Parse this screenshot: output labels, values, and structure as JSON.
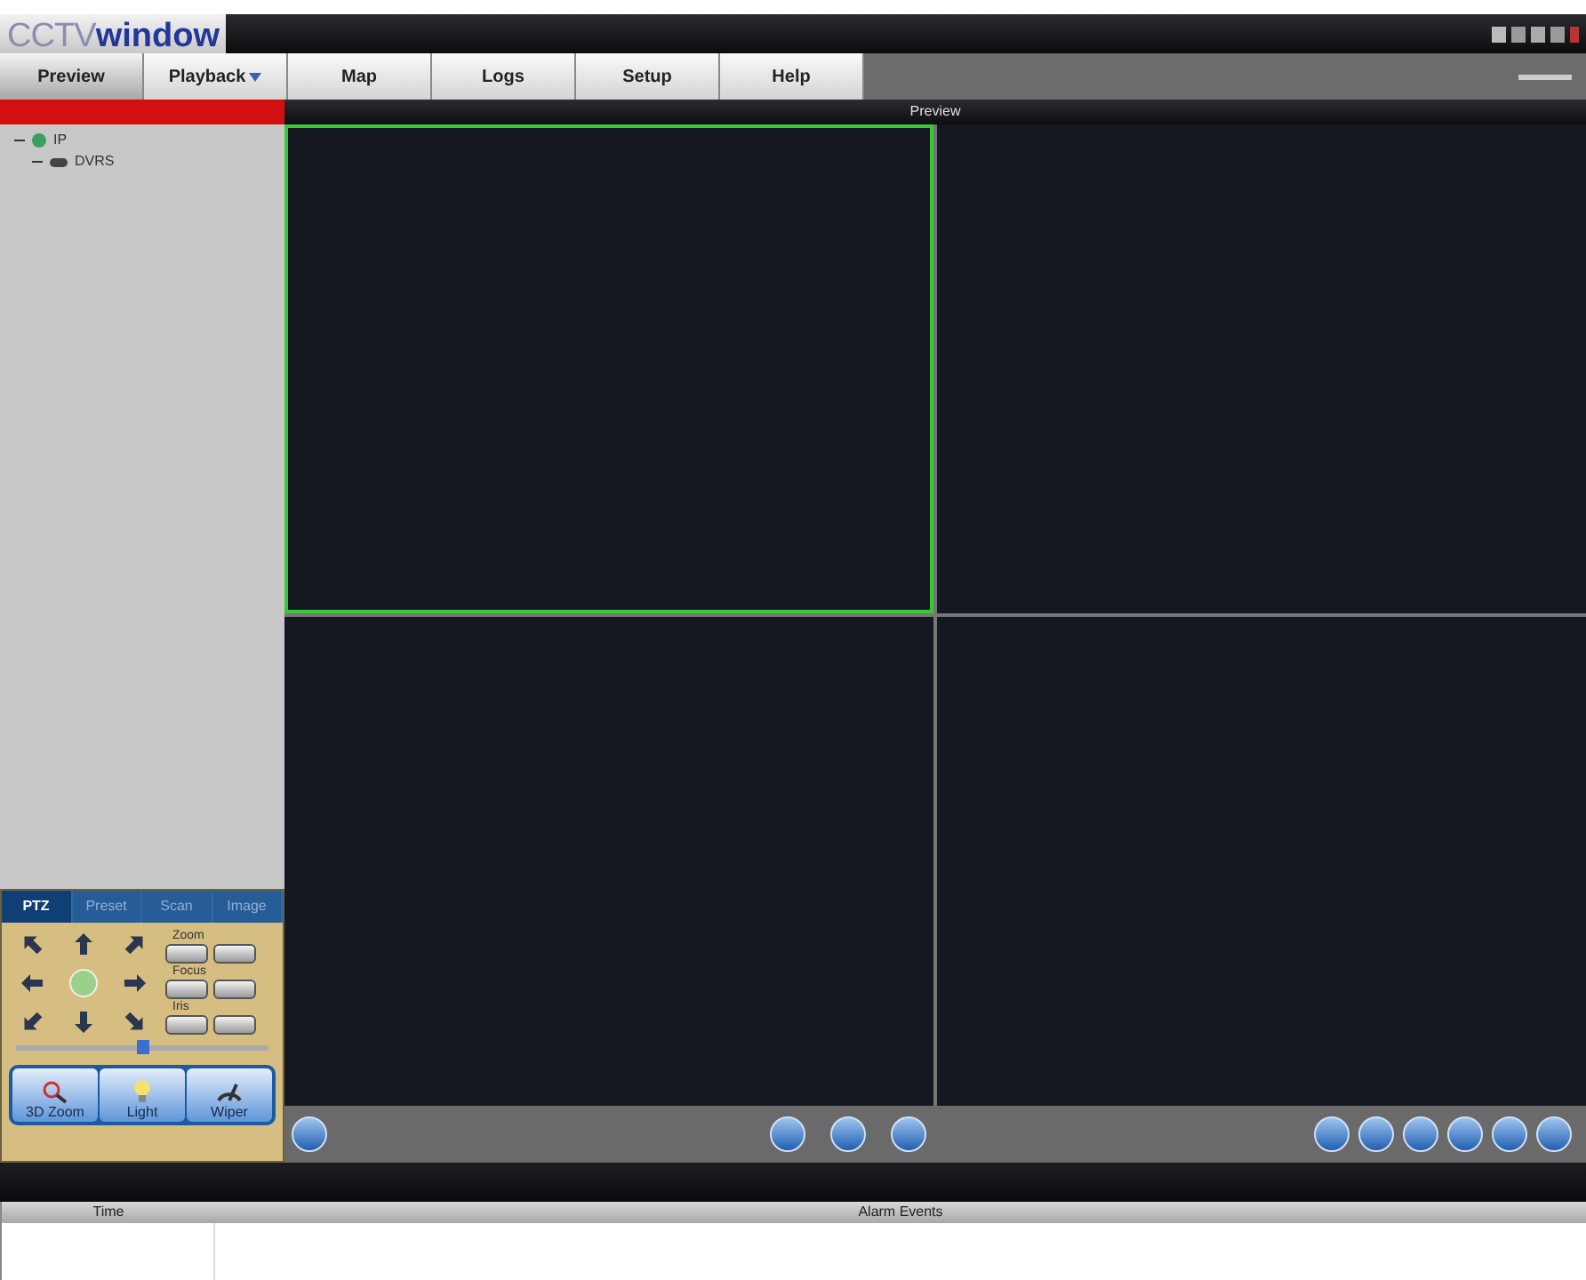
{
  "logo": {
    "part1": "CCTV",
    "part2": "window"
  },
  "menu": [
    {
      "label": "Preview",
      "selected": true,
      "dropdown": false
    },
    {
      "label": "Playback",
      "selected": false,
      "dropdown": true
    },
    {
      "label": "Map",
      "selected": false,
      "dropdown": false
    },
    {
      "label": "Logs",
      "selected": false,
      "dropdown": false
    },
    {
      "label": "Setup",
      "selected": false,
      "dropdown": false
    },
    {
      "label": "Help",
      "selected": false,
      "dropdown": false
    }
  ],
  "device_tree": [
    {
      "label": "IP",
      "expanded": true,
      "children": [
        {
          "label": "DVRS",
          "expanded": true
        }
      ]
    }
  ],
  "preview": {
    "title": "Preview",
    "cells": [
      {
        "selected": true
      },
      {
        "selected": false
      },
      {
        "selected": false
      },
      {
        "selected": false
      }
    ]
  },
  "ptz": {
    "tabs": [
      {
        "label": "PTZ",
        "selected": true
      },
      {
        "label": "Preset",
        "selected": false
      },
      {
        "label": "Scan",
        "selected": false
      },
      {
        "label": "Image",
        "selected": false
      }
    ],
    "controls": [
      {
        "label": "Zoom"
      },
      {
        "label": "Focus"
      },
      {
        "label": "Iris"
      }
    ],
    "speed": {
      "level": 0.5
    },
    "buttons": [
      {
        "label": "3D Zoom",
        "kind": "zoom"
      },
      {
        "label": "Light",
        "kind": "light"
      },
      {
        "label": "Wiper",
        "kind": "wiper"
      }
    ]
  },
  "alarm_table": {
    "columns": [
      "Time",
      "Alarm Events"
    ]
  }
}
